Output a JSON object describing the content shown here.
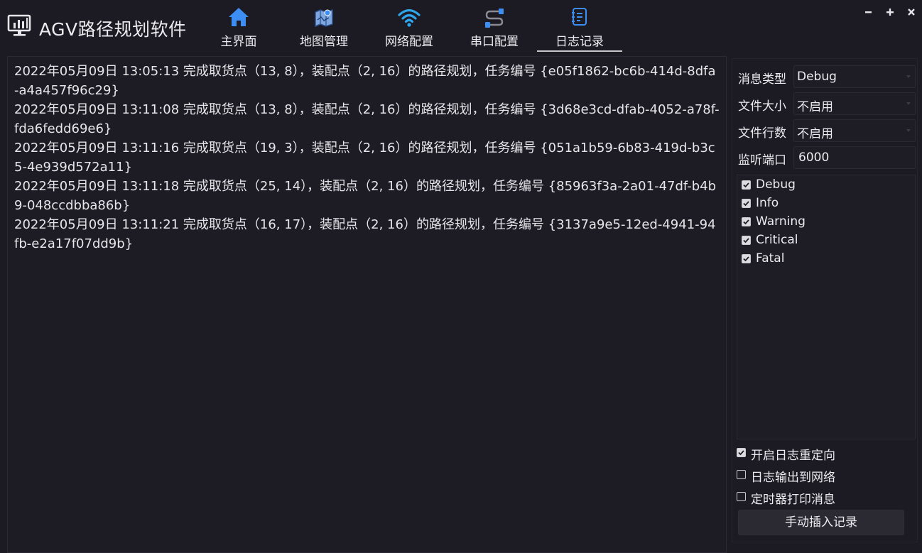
{
  "app": {
    "title": "AGV路径规划软件"
  },
  "nav": {
    "tabs": [
      {
        "label": "主界面",
        "icon": "home-icon"
      },
      {
        "label": "地图管理",
        "icon": "map-icon"
      },
      {
        "label": "网络配置",
        "icon": "wifi-icon"
      },
      {
        "label": "串口配置",
        "icon": "serial-cable-icon"
      },
      {
        "label": "日志记录",
        "icon": "log-icon"
      }
    ],
    "active": "日志记录"
  },
  "window_controls": {
    "minimize": "minimize-icon",
    "maximize": "maximize-icon",
    "close": "close-icon"
  },
  "log": {
    "lines": [
      " 2022年05月09日 13:05:13 完成取货点（13, 8），装配点（2, 16）的路径规划，任务编号 {e05f1862-bc6b-414d-8dfa-a4a457f96c29}",
      " 2022年05月09日 13:11:08 完成取货点（13, 8），装配点（2, 16）的路径规划，任务编号 {3d68e3cd-dfab-4052-a78f-fda6fedd69e6}",
      " 2022年05月09日 13:11:16 完成取货点（19, 3），装配点（2, 16）的路径规划，任务编号 {051a1b59-6b83-419d-b3c5-4e939d572a11}",
      " 2022年05月09日 13:11:18 完成取货点（25, 14），装配点（2, 16）的路径规划，任务编号 {85963f3a-2a01-47df-b4b9-048ccdbba86b}",
      " 2022年05月09日 13:11:21 完成取货点（16, 17），装配点（2, 16）的路径规划，任务编号 {3137a9e5-12ed-4941-94fb-e2a17f07dd9b}"
    ]
  },
  "settings": {
    "message_type": {
      "label": "消息类型",
      "value": "Debug"
    },
    "file_size": {
      "label": "文件大小",
      "value": "不启用"
    },
    "file_lines": {
      "label": "文件行数",
      "value": "不启用"
    },
    "listen_port": {
      "label": "监听端口",
      "value": "6000"
    },
    "levels": [
      {
        "label": "Debug",
        "checked": true
      },
      {
        "label": "Info",
        "checked": true
      },
      {
        "label": "Warning",
        "checked": true
      },
      {
        "label": "Critical",
        "checked": true
      },
      {
        "label": "Fatal",
        "checked": true
      }
    ],
    "options": {
      "redirect": {
        "label": "开启日志重定向",
        "checked": true
      },
      "network_output": {
        "label": "日志输出到网络",
        "checked": false
      },
      "timer_print": {
        "label": "定时器打印消息",
        "checked": false
      }
    },
    "insert_button": "手动插入记录"
  },
  "colors": {
    "background": "#1c1a23",
    "accent_blue": "#3d8ef2",
    "text": "#ececf0"
  }
}
